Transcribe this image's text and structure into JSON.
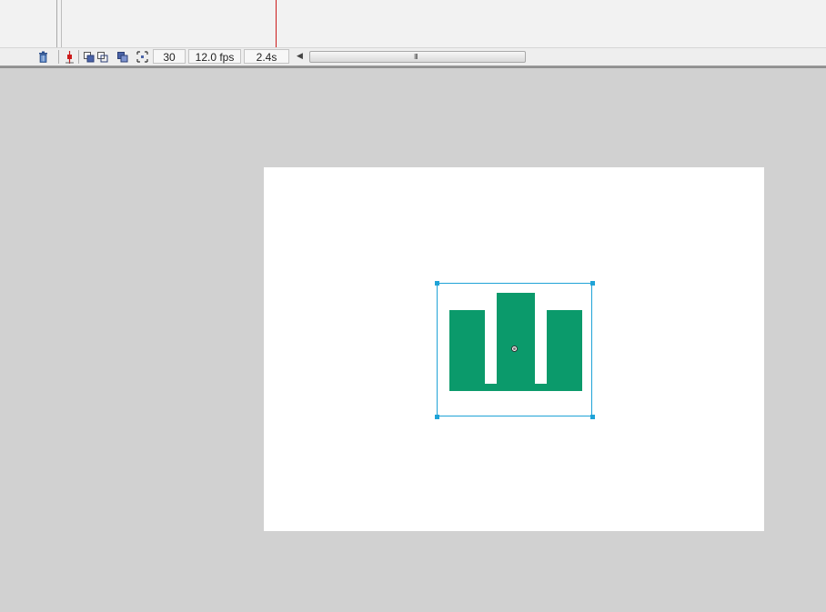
{
  "timeline": {
    "current_frame": "30",
    "frame_rate": "12.0 fps",
    "elapsed_time": "2.4s"
  },
  "icons": {
    "delete_layer": "trash-icon",
    "center_frame": "center-frame-icon",
    "onion_skin": "onion-skin-icon",
    "onion_skin_outlines": "onion-skin-outlines-icon",
    "edit_multiple_frames": "edit-multiple-frames-icon",
    "modify_markers": "modify-onion-markers-icon",
    "scroll_left": "scroll-left-arrow-icon",
    "scroll_grip": "scroll-grip-icon"
  },
  "colors": {
    "shape_fill": "#0b9a6b",
    "selection": "#1fa3d7",
    "playhead": "#cc1b1b",
    "stage": "#ffffff",
    "workspace": "#d1d1d1"
  }
}
